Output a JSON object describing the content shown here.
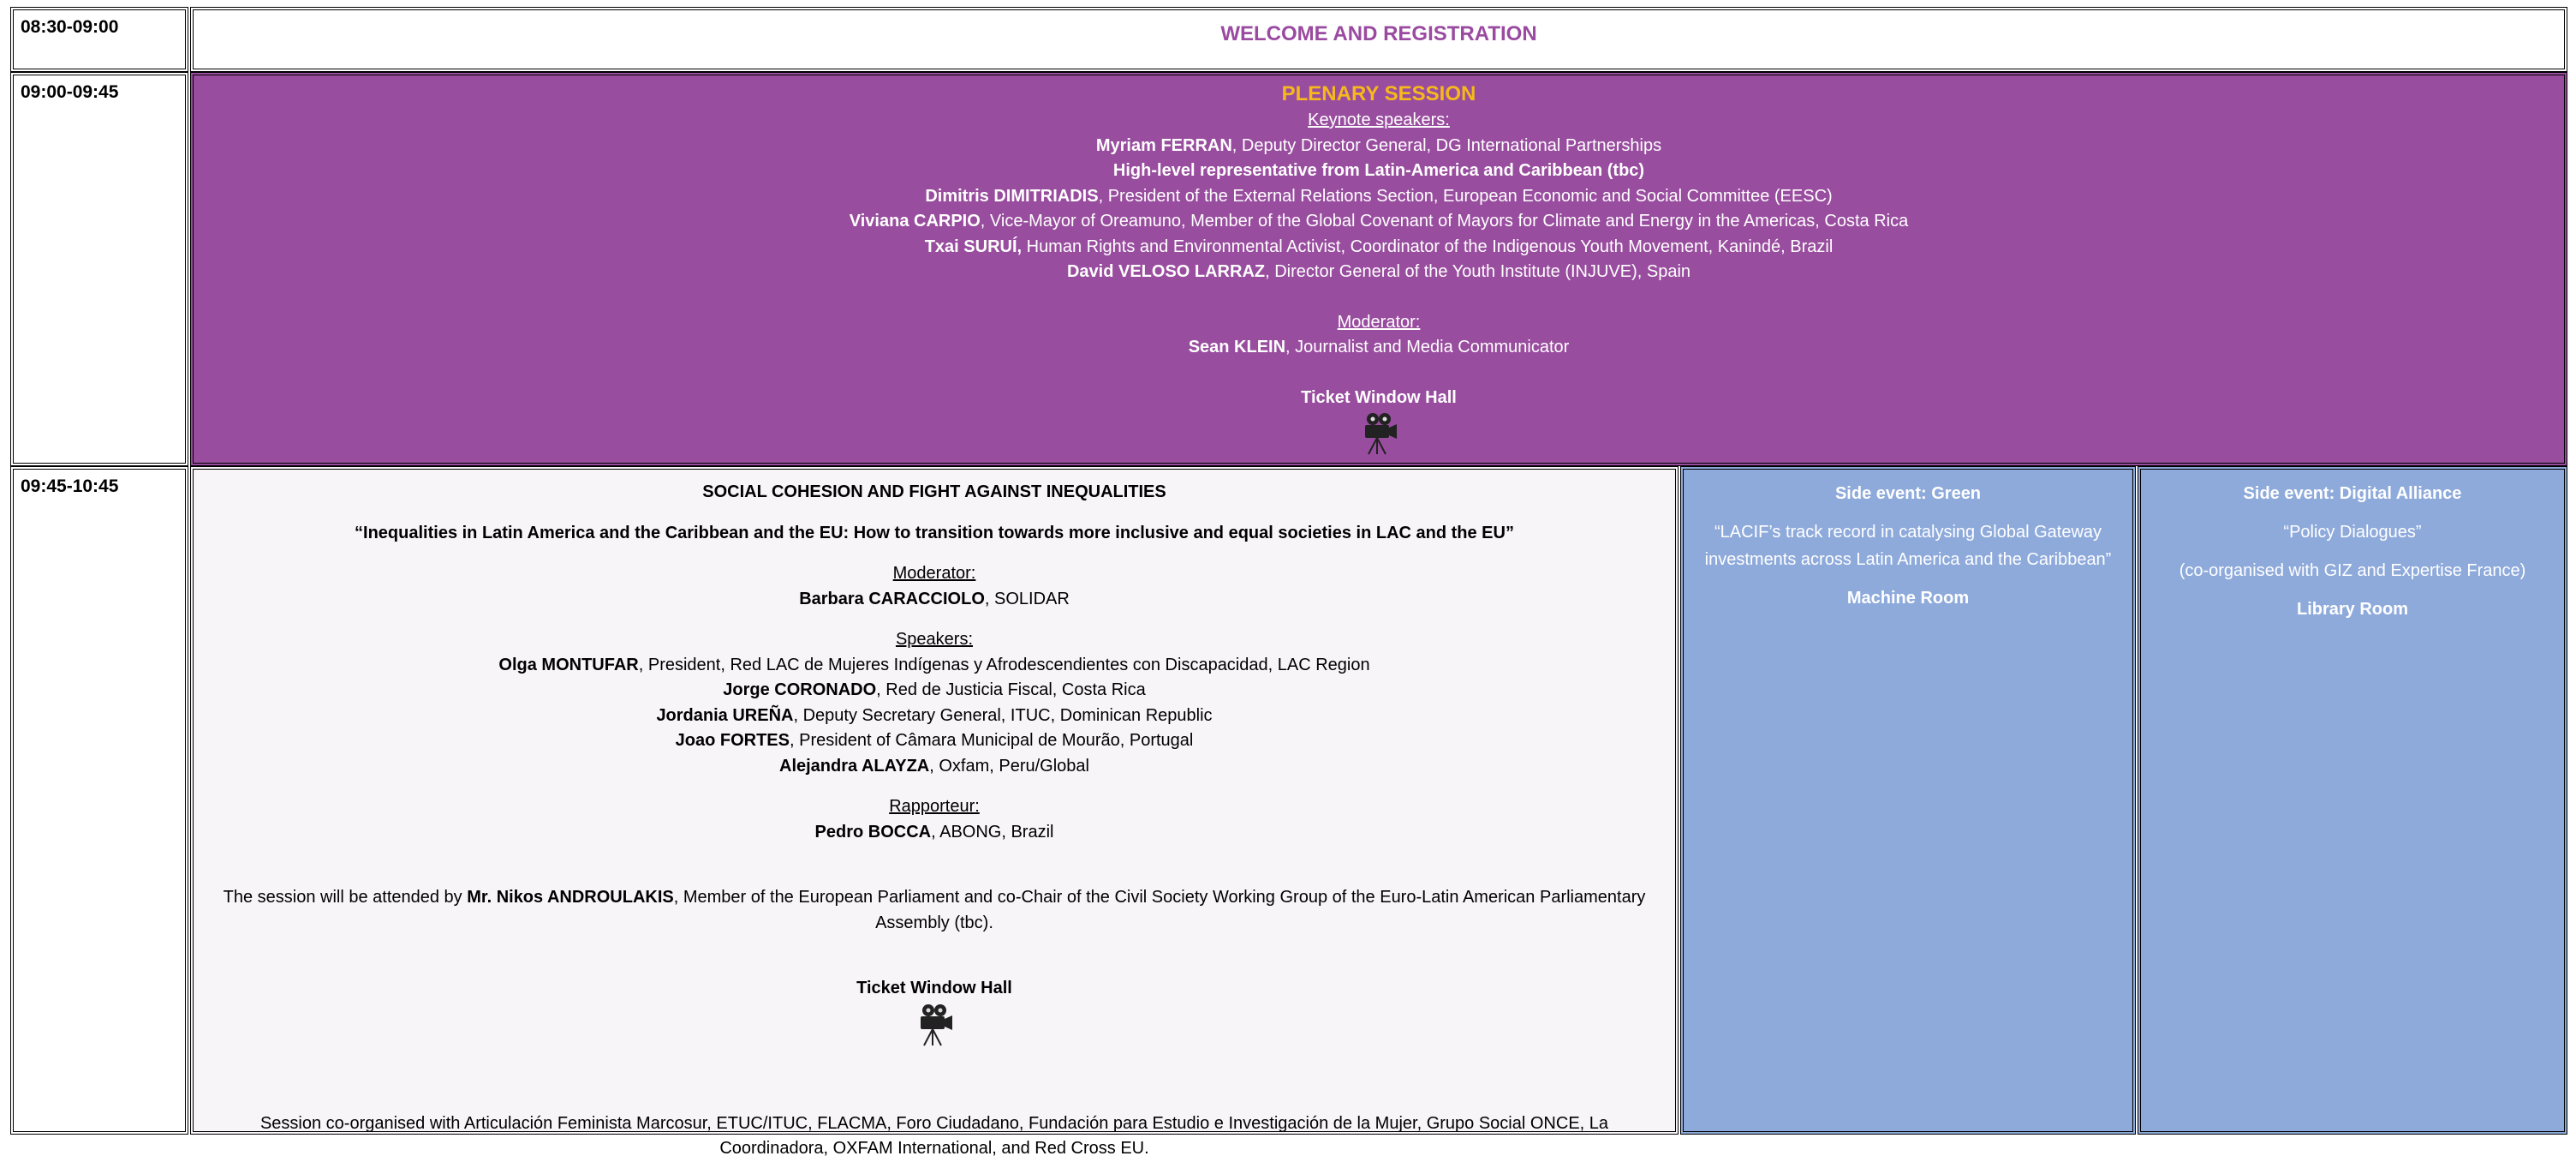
{
  "rows": {
    "welcome": {
      "time": "08:30-09:00",
      "title": "WELCOME AND REGISTRATION"
    },
    "plenary": {
      "time": "09:00-09:45",
      "title": "PLENARY SESSION",
      "keynote_label": "Keynote speakers:",
      "speakers": [
        {
          "name": "Myriam FERRAN",
          "role": ", Deputy Director General, DG International Partnerships"
        },
        {
          "name": "High-level representative from Latin-America and Caribbean (tbc)",
          "role": ""
        },
        {
          "name": "Dimitris DIMITRIADIS",
          "role": ", President of the External Relations Section, European Economic and Social Committee (EESC)"
        },
        {
          "name": "Viviana CARPIO",
          "role": ", Vice-Mayor of Oreamuno, Member of the Global Covenant of Mayors for Climate and Energy in the Americas, Costa Rica"
        },
        {
          "name": "Txai SURUÍ,",
          "role": " Human Rights and Environmental Activist, Coordinator of the Indigenous Youth Movement, Kanindé, Brazil"
        },
        {
          "name": "David VELOSO LARRAZ",
          "role": ", Director General of the Youth Institute (INJUVE), Spain"
        }
      ],
      "moderator_label": "Moderator:",
      "moderator_name": "Sean KLEIN",
      "moderator_role": ", Journalist and Media Communicator",
      "room": "Ticket Window Hall",
      "icon": "video-camera-icon"
    },
    "main": {
      "time": "09:45-10:45",
      "title": "SOCIAL COHESION AND FIGHT AGAINST INEQUALITIES",
      "subtitle": "“Inequalities in Latin America and the Caribbean and the EU: How to transition towards more inclusive and equal societies in LAC and the EU”",
      "moderator_label": "Moderator:",
      "moderator_name": "Barbara CARACCIOLO",
      "moderator_role": ", SOLIDAR",
      "speakers_label": "Speakers:",
      "speakers": [
        {
          "name": "Olga MONTUFAR",
          "role": ", President, Red LAC de Mujeres Indígenas y Afrodescendientes con Discapacidad, LAC Region"
        },
        {
          "name": "Jorge CORONADO",
          "role": ", Red de Justicia Fiscal, Costa Rica"
        },
        {
          "name": "Jordania UREÑA",
          "role": ", Deputy Secretary General, ITUC, Dominican Republic"
        },
        {
          "name": "Joao FORTES",
          "role": ", President of Câmara Municipal de Mourão, Portugal"
        },
        {
          "name": "Alejandra ALAYZA",
          "role": ", Oxfam, Peru/Global"
        }
      ],
      "rapporteur_label": "Rapporteur:",
      "rapporteur_name": "Pedro BOCCA",
      "rapporteur_role": ", ABONG, Brazil",
      "attended_pre": "The session will be attended by ",
      "attended_name": "Mr. Nikos ANDROULAKIS",
      "attended_post": ", Member of the European Parliament and co-Chair of the Civil Society Working Group of the Euro-Latin American Parliamentary Assembly (tbc).",
      "room": "Ticket Window Hall",
      "icon": "video-camera-icon",
      "coorganised": "Session co-organised with Articulación Feminista Marcosur, ETUC/ITUC, FLACMA, Foro Ciudadano, Fundación para Estudio e Investigación de la Mujer, Grupo Social ONCE, La Coordinadora, OXFAM International, and Red Cross EU."
    },
    "side_green": {
      "title": "Side event: Green",
      "description": "“LACIF’s track record in catalysing Global Gateway investments across Latin America and the Caribbean”",
      "room": "Machine Room"
    },
    "side_digital": {
      "title": "Side event: Digital Alliance",
      "description": "“Policy Dialogues”",
      "organised": "(co-organised with GIZ and Expertise France)",
      "room": "Library Room"
    }
  },
  "colors": {
    "plenary_bg": "#994d9f",
    "plenary_title": "#f6b91b",
    "welcome_title": "#9a4aa0",
    "side_bg": "#8eaadb",
    "main_bg": "#f8f5f8"
  }
}
